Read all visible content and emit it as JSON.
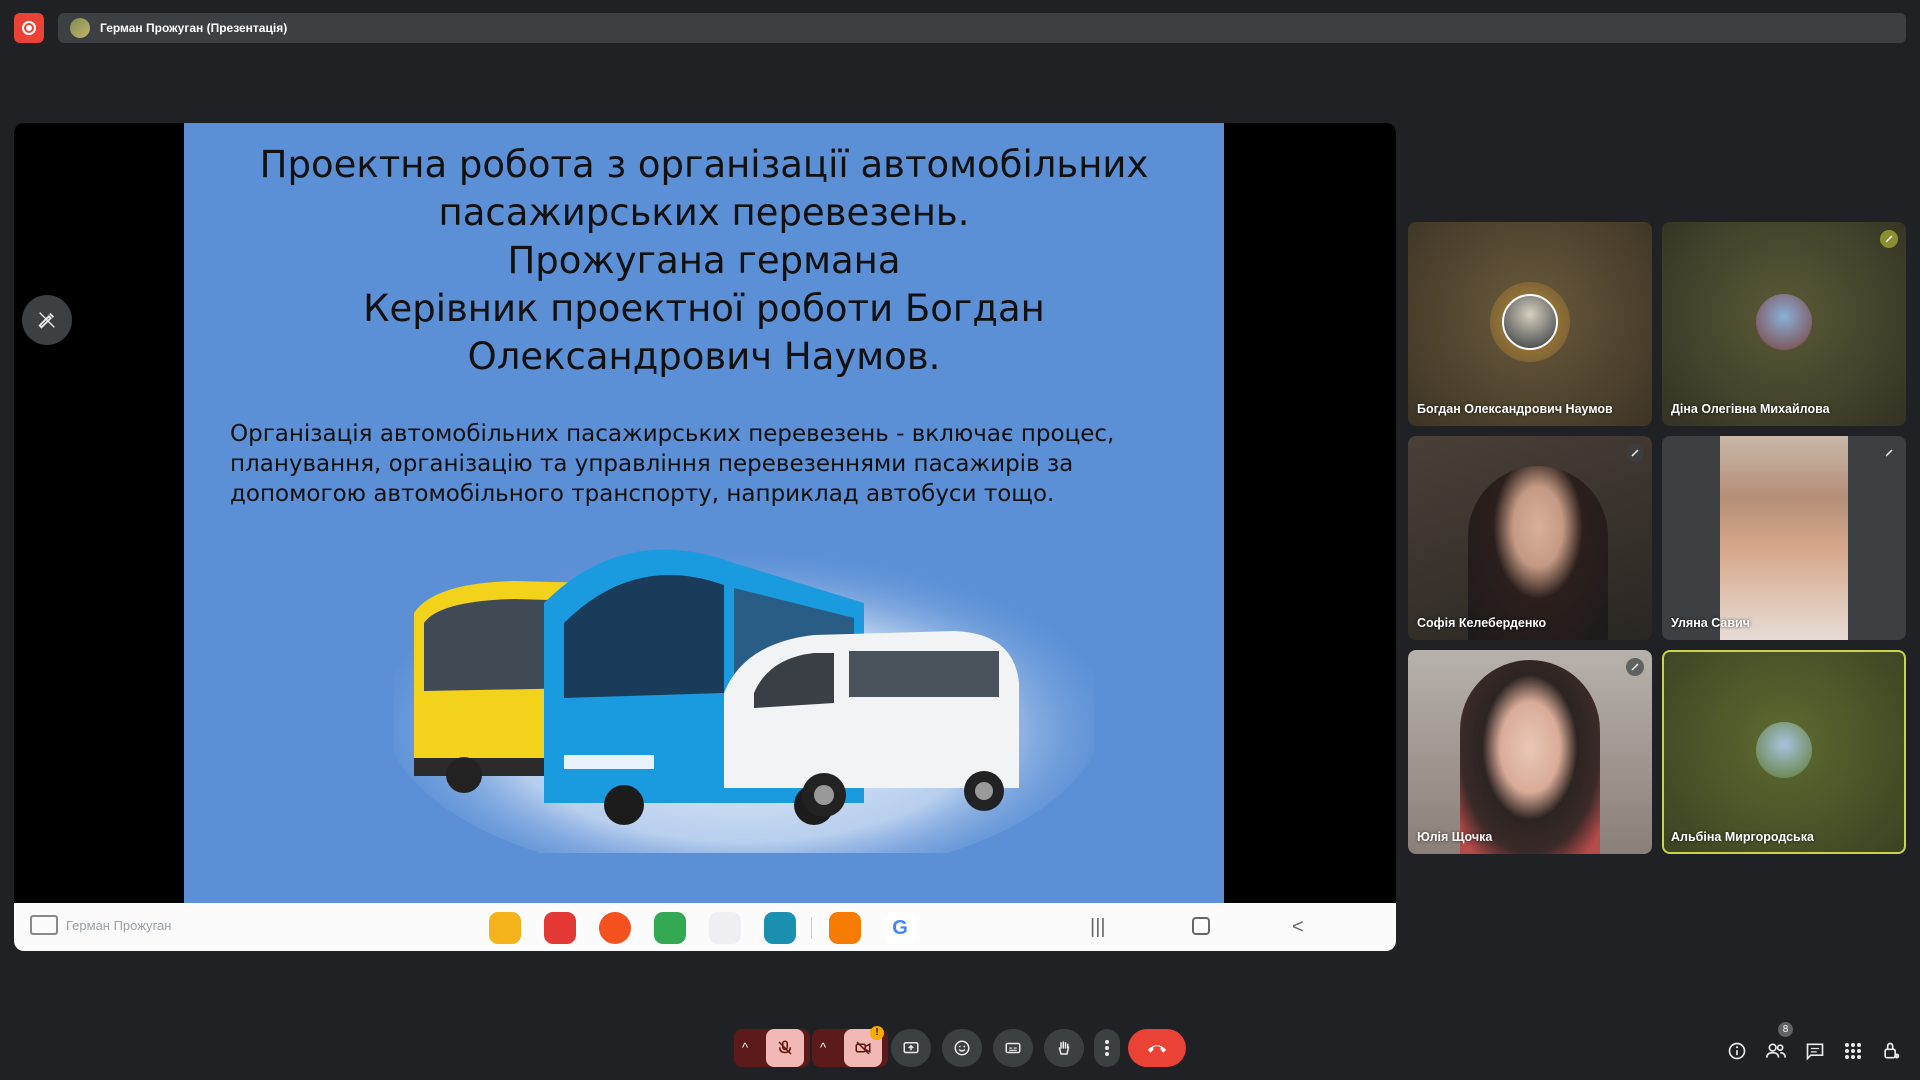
{
  "meeting": {
    "presenter_banner": "Герман Прожуган (Презентація)",
    "presenter_name": "Герман Прожуган",
    "people_count": "8",
    "video_alert": "!"
  },
  "slide": {
    "title_lines": [
      "Проектна робота з організації автомобільних",
      "пасажирських перевезень.",
      "Прожугана германа",
      "Керівник проектної роботи Богдан",
      "Олександрович Наумов."
    ],
    "body_lines": [
      "Організація автомобільних пасажирських перевезень - включає процес,",
      "планування, організацію та управління перевезеннями пасажирів за",
      "допомогою автомобільного транспорту, наприклад автобуси тощо."
    ]
  },
  "participants": [
    {
      "name": "Богдан Олександрович Наумов"
    },
    {
      "name": "Діна Олегівна Михайлова"
    },
    {
      "name": "Софія Келеберденко"
    },
    {
      "name": "Уляна Савич"
    },
    {
      "name": "Юлія Щочка"
    },
    {
      "name": "Альбіна Миргородська"
    }
  ],
  "colors": {
    "background": "#202124",
    "end_call": "#ea4335",
    "mic_off_active": "#f2b8b5",
    "slide_bg": "#5b8fd6",
    "active_speaker_border": "#c8d34b"
  },
  "icons": {
    "record": "record-icon",
    "annotate": "pen-icon",
    "mic": "mic-off-icon",
    "camera": "camera-off-icon",
    "present": "present-icon",
    "emoji": "emoji-icon",
    "captions": "captions-icon",
    "hand": "raise-hand-icon",
    "more": "more-vert-icon",
    "end": "end-call-icon",
    "info": "info-icon",
    "people": "people-icon",
    "chat": "chat-icon",
    "activities": "apps-icon",
    "host": "host-controls-icon"
  }
}
